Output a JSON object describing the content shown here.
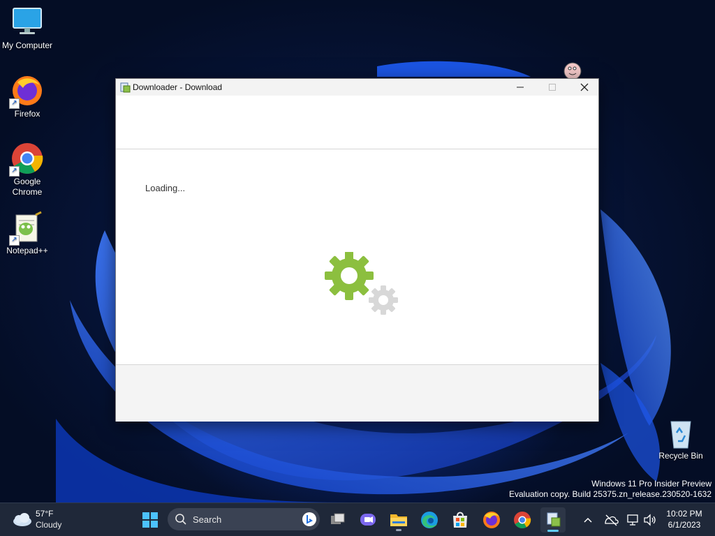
{
  "desktop": {
    "icons": [
      {
        "label": "My Computer",
        "icon": "monitor-icon"
      },
      {
        "label": "Firefox",
        "icon": "firefox-icon"
      },
      {
        "label": "Google Chrome",
        "icon": "chrome-icon"
      },
      {
        "label": "Notepad++",
        "icon": "notepadpp-icon"
      },
      {
        "label": "Recycle Bin",
        "icon": "recycle-bin-icon"
      }
    ],
    "watermark": {
      "line1": "Windows 11 Pro Insider Preview",
      "line2": "Evaluation copy. Build 25375.zn_release.230520-1632"
    }
  },
  "window": {
    "title": "Downloader - Download",
    "loading_text": "Loading...",
    "colors": {
      "gear_primary": "#8cbf3f",
      "gear_secondary": "#d8d8d8"
    }
  },
  "taskbar": {
    "weather": {
      "temp": "57°F",
      "condition": "Cloudy"
    },
    "search": {
      "label": "Search"
    },
    "apps": [
      "start-icon",
      "search-icon",
      "task-view-icon",
      "teams-chat-icon",
      "file-explorer-icon",
      "edge-icon",
      "store-icon",
      "firefox-icon",
      "chrome-icon",
      "downloader-icon"
    ],
    "tray": [
      "chevron-up-icon",
      "onedrive-offline-icon",
      "network-icon",
      "volume-icon"
    ],
    "clock": {
      "time": "10:02 PM",
      "date": "6/1/2023"
    }
  },
  "colors": {
    "accent": "#60cdff",
    "taskbar_bg": "#1f2839"
  }
}
